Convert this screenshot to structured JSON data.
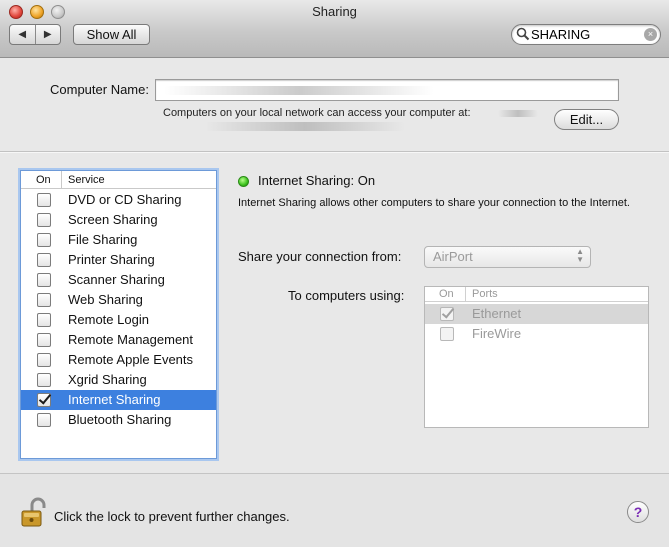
{
  "window": {
    "title": "Sharing"
  },
  "toolbar": {
    "back_label": "◀",
    "forward_label": "▶",
    "show_all_label": "Show All",
    "search_value": "SHARING",
    "search_clear_label": "×"
  },
  "computer_name": {
    "label": "Computer Name:",
    "value": "",
    "access_text": "Computers on your local network can access your computer at:",
    "edit_label": "Edit..."
  },
  "services": {
    "header_on": "On",
    "header_service": "Service",
    "items": [
      {
        "label": "DVD or CD Sharing",
        "checked": false,
        "selected": false
      },
      {
        "label": "Screen Sharing",
        "checked": false,
        "selected": false
      },
      {
        "label": "File Sharing",
        "checked": false,
        "selected": false
      },
      {
        "label": "Printer Sharing",
        "checked": false,
        "selected": false
      },
      {
        "label": "Scanner Sharing",
        "checked": false,
        "selected": false
      },
      {
        "label": "Web Sharing",
        "checked": false,
        "selected": false
      },
      {
        "label": "Remote Login",
        "checked": false,
        "selected": false
      },
      {
        "label": "Remote Management",
        "checked": false,
        "selected": false
      },
      {
        "label": "Remote Apple Events",
        "checked": false,
        "selected": false
      },
      {
        "label": "Xgrid Sharing",
        "checked": false,
        "selected": false
      },
      {
        "label": "Internet Sharing",
        "checked": true,
        "selected": true
      },
      {
        "label": "Bluetooth Sharing",
        "checked": false,
        "selected": false
      }
    ]
  },
  "detail": {
    "status": "Internet Sharing: On",
    "status_color": "#3cc21d",
    "description": "Internet Sharing allows other computers to share your connection to the Internet.",
    "share_from_label": "Share your connection from:",
    "share_from_value": "AirPort",
    "to_computers_label": "To computers using:",
    "ports_header_on": "On",
    "ports_header_ports": "Ports",
    "ports": [
      {
        "label": "Ethernet",
        "checked": true,
        "selected": true
      },
      {
        "label": "FireWire",
        "checked": false,
        "selected": false
      }
    ]
  },
  "footer": {
    "lock_text": "Click the lock to prevent further changes.",
    "help_label": "?"
  },
  "colors": {
    "selection": "#3d80df",
    "help_accent": "#7a2bb5",
    "lock_gold": "#c9972a"
  }
}
